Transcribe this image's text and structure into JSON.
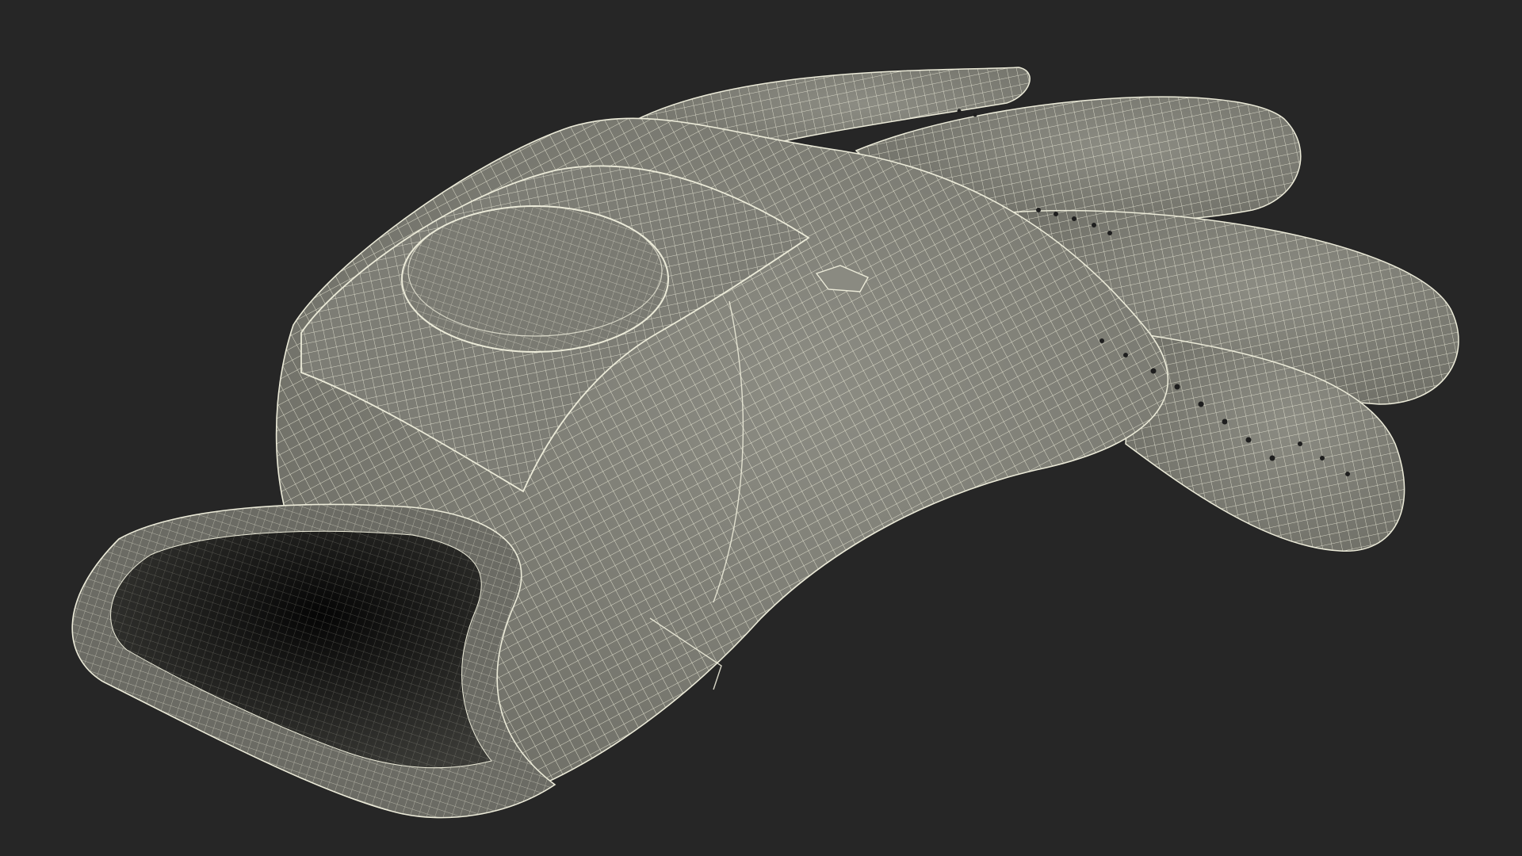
{
  "scene": {
    "background_color": "#262626",
    "model_fill_color": "#84847b",
    "model_shadow_color": "#5f5f57",
    "wire_color": "#ecebd9",
    "interior_color": "#141414",
    "subject_icon": "golf-glove-wireframe"
  }
}
